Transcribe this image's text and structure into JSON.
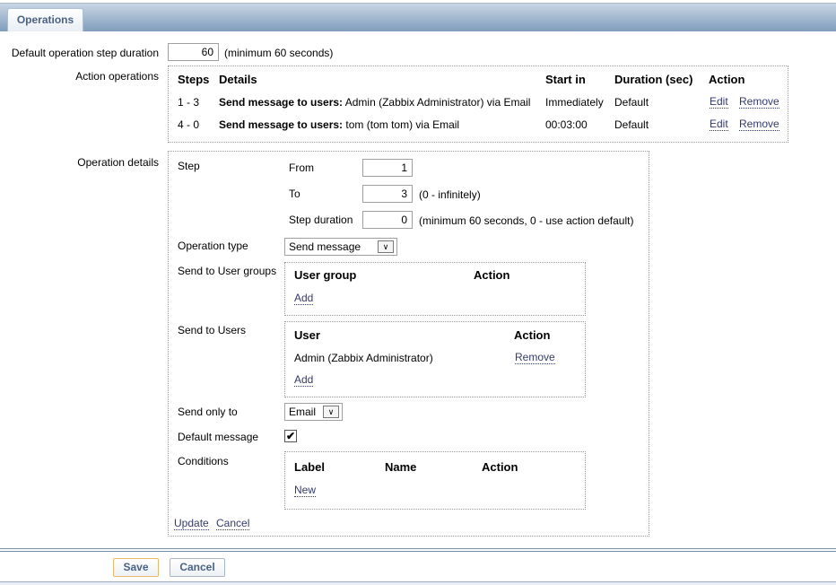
{
  "tab": {
    "label": "Operations"
  },
  "default_step": {
    "label": "Default operation step duration",
    "value": "60",
    "hint": "(minimum 60 seconds)"
  },
  "action_operations": {
    "label": "Action operations",
    "headers": [
      "Steps",
      "Details",
      "Start in",
      "Duration (sec)",
      "Action"
    ],
    "rows": [
      {
        "steps": "1 - 3",
        "details_bold": "Send message to users:",
        "details": " Admin (Zabbix Administrator) via Email",
        "start": "Immediately",
        "duration": "Default",
        "edit": "Edit",
        "remove": "Remove"
      },
      {
        "steps": "4 - 0",
        "details_bold": "Send message to users:",
        "details": " tom (tom tom) via Email",
        "start": "00:03:00",
        "duration": "Default",
        "edit": "Edit",
        "remove": "Remove"
      }
    ]
  },
  "details": {
    "label": "Operation details",
    "step_label": "Step",
    "from_label": "From",
    "from": "1",
    "to_label": "To",
    "to": "3",
    "to_hint": "(0 - infinitely)",
    "dur_label": "Step duration",
    "dur": "0",
    "dur_hint": "(minimum 60 seconds, 0 - use action default)",
    "optype_label": "Operation type",
    "optype": "Send message",
    "groups_label": "Send to User groups",
    "groups_h1": "User group",
    "groups_h2": "Action",
    "groups_add": "Add",
    "users_label": "Send to Users",
    "users_h1": "User",
    "users_h2": "Action",
    "user1": "Admin (Zabbix Administrator)",
    "user1_remove": "Remove",
    "users_add": "Add",
    "sendonly_label": "Send only to",
    "sendonly": "Email",
    "defmsg_label": "Default message",
    "defmsg_checked": true,
    "cond_label": "Conditions",
    "cond_h1": "Label",
    "cond_h2": "Name",
    "cond_h3": "Action",
    "cond_new": "New",
    "update": "Update",
    "cancel": "Cancel"
  },
  "footer": {
    "save": "Save",
    "cancel": "Cancel"
  }
}
